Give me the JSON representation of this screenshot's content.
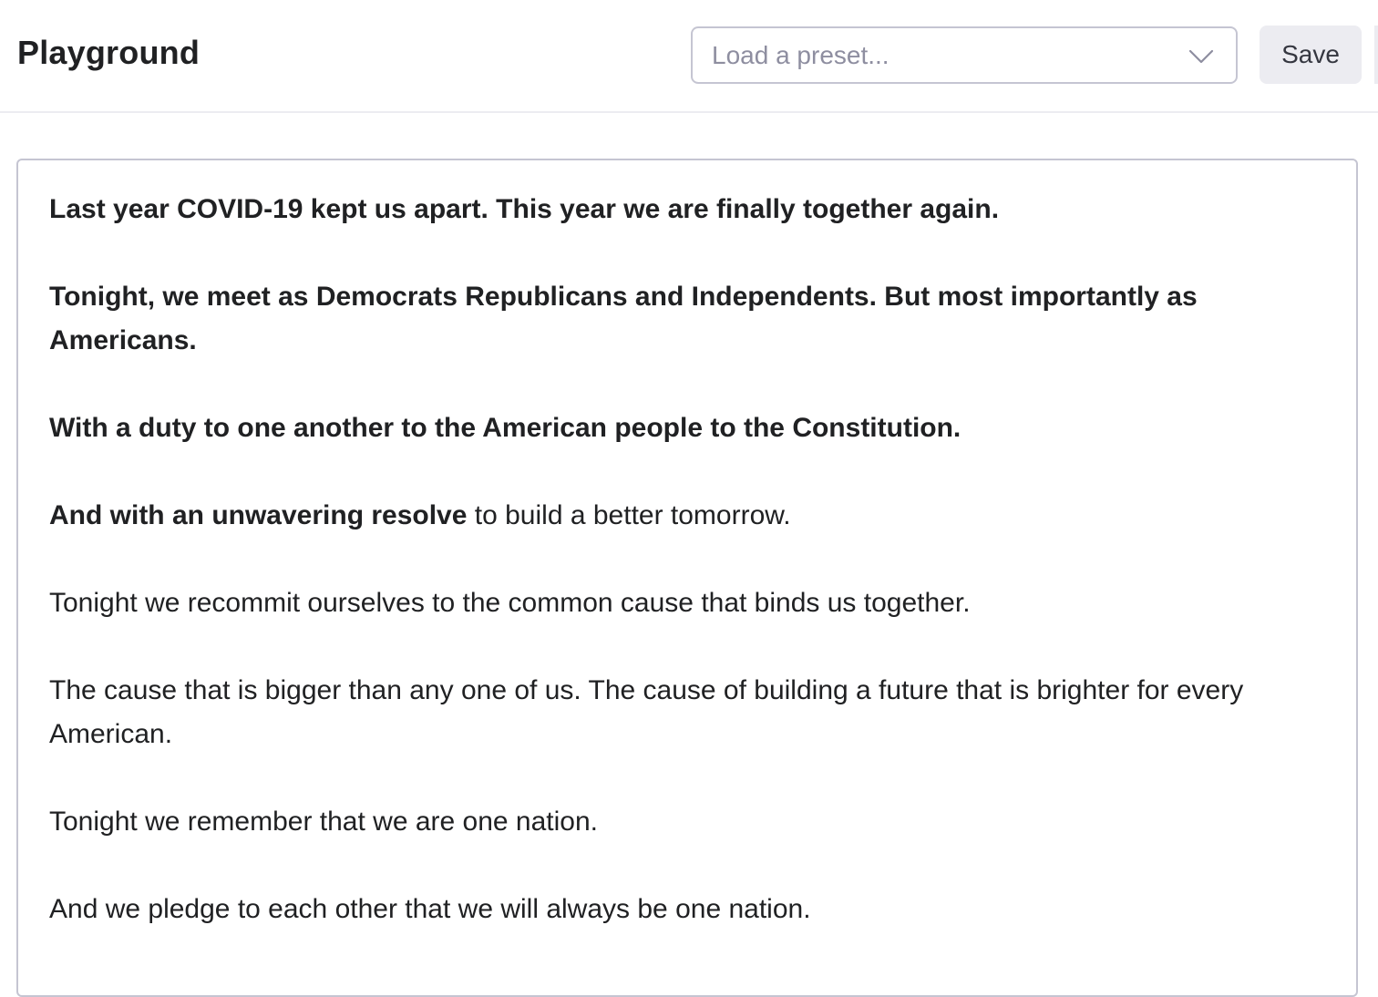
{
  "header": {
    "title": "Playground",
    "preset_placeholder": "Load a preset...",
    "save_label": "Save"
  },
  "editor": {
    "paragraphs": [
      {
        "prompt": "Last year COVID-19 kept us apart. This year we are finally together again.",
        "completion": ""
      },
      {
        "prompt": "Tonight, we meet as Democrats Republicans and Independents. But most importantly as Americans.",
        "completion": ""
      },
      {
        "prompt": "With a duty to one another to the American people to the Constitution.",
        "completion": ""
      },
      {
        "prompt": "And with an unwavering resolve",
        "completion": " to build a better tomorrow."
      },
      {
        "prompt": "",
        "completion": "Tonight we recommit ourselves to the common cause that binds us together."
      },
      {
        "prompt": "",
        "completion": "The cause that is bigger than any one of us. The cause of building a future that is brighter for every American."
      },
      {
        "prompt": "",
        "completion": "Tonight we remember that we are one nation."
      },
      {
        "prompt": "",
        "completion": "And we pledge to each other that we will always be one nation."
      }
    ]
  },
  "icons": {
    "dropdown": "chevron-down-icon"
  },
  "colors": {
    "border": "#c5c5d2",
    "button_bg": "#ececf1",
    "placeholder": "#8e8ea0",
    "text": "#202123"
  }
}
